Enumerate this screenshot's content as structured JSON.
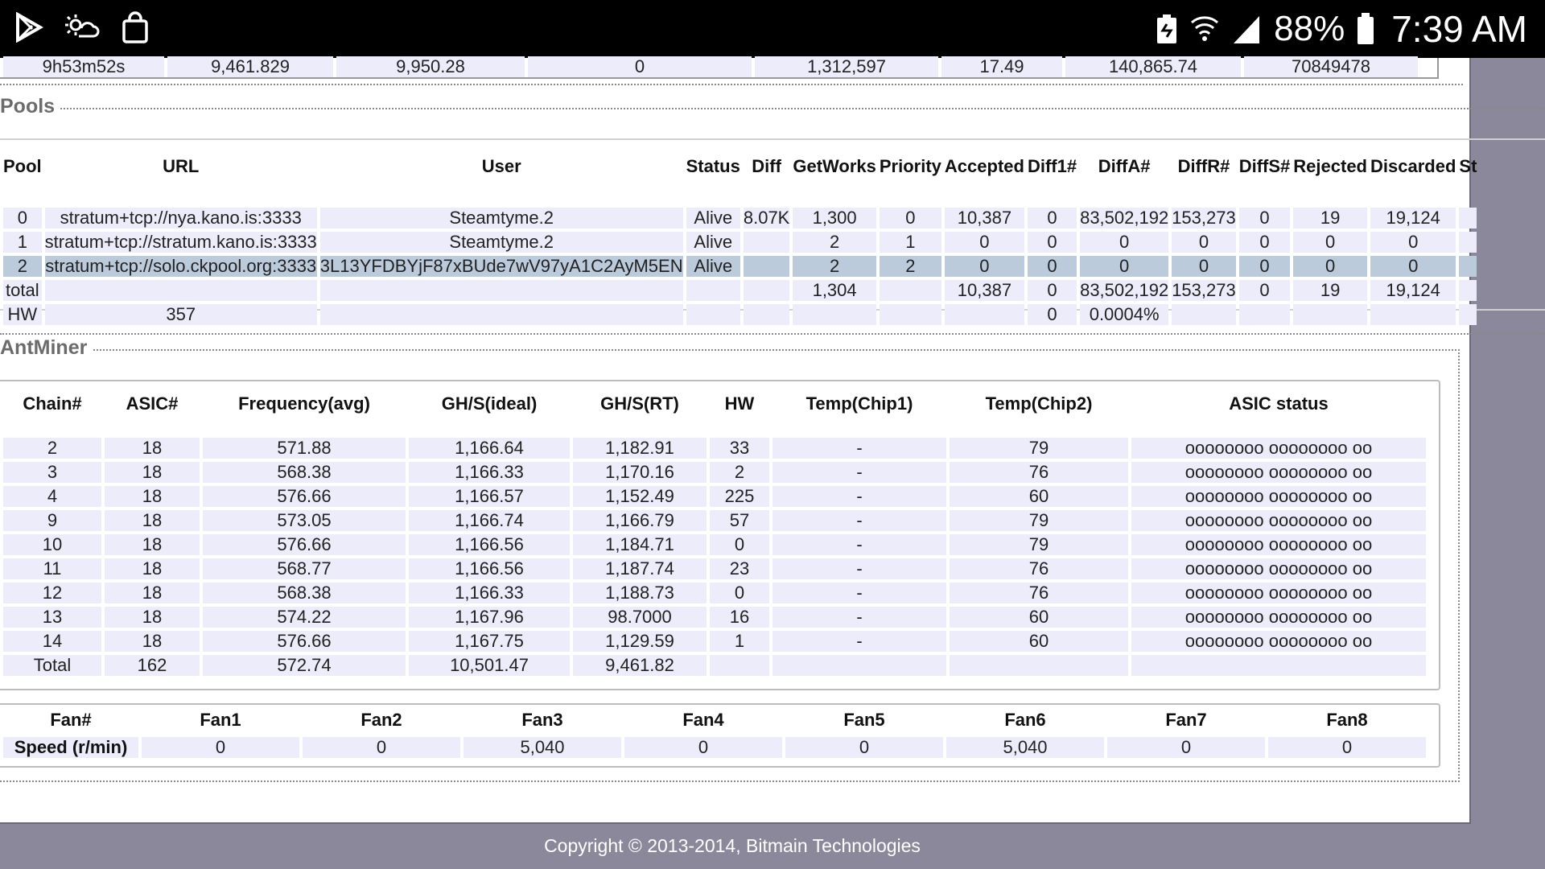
{
  "status_bar": {
    "battery_percent": "88%",
    "time": "7:39 AM",
    "left_icons": [
      "play-store-icon",
      "weather-icon",
      "shopping-bag-icon"
    ],
    "right_icons": [
      "battery-saver-icon",
      "wifi-icon",
      "signal-icon",
      "battery-icon"
    ]
  },
  "summary_row": [
    "9h53m52s",
    "9,461.829",
    "9,950.28",
    "0",
    "1,312,597",
    "17.49",
    "140,865.74",
    "70849478"
  ],
  "pools": {
    "legend": "Pools",
    "headers": [
      "Pool",
      "URL",
      "User",
      "Status",
      "Diff",
      "GetWorks",
      "Priority",
      "Accepted",
      "Diff1#",
      "DiffA#",
      "DiffR#",
      "DiffS#",
      "Rejected",
      "Discarded",
      "St"
    ],
    "rows": [
      [
        "0",
        "stratum+tcp://nya.kano.is:3333",
        "Steamtyme.2",
        "Alive",
        "8.07K",
        "1,300",
        "0",
        "10,387",
        "0",
        "83,502,192",
        "153,273",
        "0",
        "19",
        "19,124",
        ""
      ],
      [
        "1",
        "stratum+tcp://stratum.kano.is:3333",
        "Steamtyme.2",
        "Alive",
        "",
        "2",
        "1",
        "0",
        "0",
        "0",
        "0",
        "0",
        "0",
        "0",
        ""
      ],
      [
        "2",
        "stratum+tcp://solo.ckpool.org:3333",
        "3L13YFDBYjF87xBUde7wV97yA1C2AyM5EN",
        "Alive",
        "",
        "2",
        "2",
        "0",
        "0",
        "0",
        "0",
        "0",
        "0",
        "0",
        ""
      ],
      [
        "total",
        "",
        "",
        "",
        "",
        "1,304",
        "",
        "10,387",
        "0",
        "83,502,192",
        "153,273",
        "0",
        "19",
        "19,124",
        ""
      ],
      [
        "HW",
        "357",
        "",
        "",
        "",
        "",
        "",
        "",
        "0",
        "0.0004%",
        "",
        "",
        "",
        "",
        ""
      ]
    ]
  },
  "antminer": {
    "legend": "AntMiner",
    "headers": [
      "Chain#",
      "ASIC#",
      "Frequency(avg)",
      "GH/S(ideal)",
      "GH/S(RT)",
      "HW",
      "Temp(Chip1)",
      "Temp(Chip2)",
      "ASIC status"
    ],
    "rows": [
      [
        "2",
        "18",
        "571.88",
        "1,166.64",
        "1,182.91",
        "33",
        "-",
        "79",
        "oooooooo oooooooo oo"
      ],
      [
        "3",
        "18",
        "568.38",
        "1,166.33",
        "1,170.16",
        "2",
        "-",
        "76",
        "oooooooo oooooooo oo"
      ],
      [
        "4",
        "18",
        "576.66",
        "1,166.57",
        "1,152.49",
        "225",
        "-",
        "60",
        "oooooooo oooooooo oo"
      ],
      [
        "9",
        "18",
        "573.05",
        "1,166.74",
        "1,166.79",
        "57",
        "-",
        "79",
        "oooooooo oooooooo oo"
      ],
      [
        "10",
        "18",
        "576.66",
        "1,166.56",
        "1,184.71",
        "0",
        "-",
        "79",
        "oooooooo oooooooo oo"
      ],
      [
        "11",
        "18",
        "568.77",
        "1,166.56",
        "1,187.74",
        "23",
        "-",
        "76",
        "oooooooo oooooooo oo"
      ],
      [
        "12",
        "18",
        "568.38",
        "1,166.33",
        "1,188.73",
        "0",
        "-",
        "76",
        "oooooooo oooooooo oo"
      ],
      [
        "13",
        "18",
        "574.22",
        "1,167.96",
        "98.7000",
        "16",
        "-",
        "60",
        "oooooooo oooooooo oo"
      ],
      [
        "14",
        "18",
        "576.66",
        "1,167.75",
        "1,129.59",
        "1",
        "-",
        "60",
        "oooooooo oooooooo oo"
      ],
      [
        "Total",
        "162",
        "572.74",
        "10,501.47",
        "9,461.82",
        "",
        "",
        "",
        ""
      ]
    ],
    "fans": {
      "headers": [
        "Fan#",
        "Fan1",
        "Fan2",
        "Fan3",
        "Fan4",
        "Fan5",
        "Fan6",
        "Fan7",
        "Fan8"
      ],
      "speed_row": [
        "Speed (r/min)",
        "0",
        "0",
        "5,040",
        "0",
        "0",
        "5,040",
        "0",
        "0"
      ]
    }
  },
  "footer": {
    "copyright": "Copyright © 2013-2014, Bitmain Technologies"
  }
}
